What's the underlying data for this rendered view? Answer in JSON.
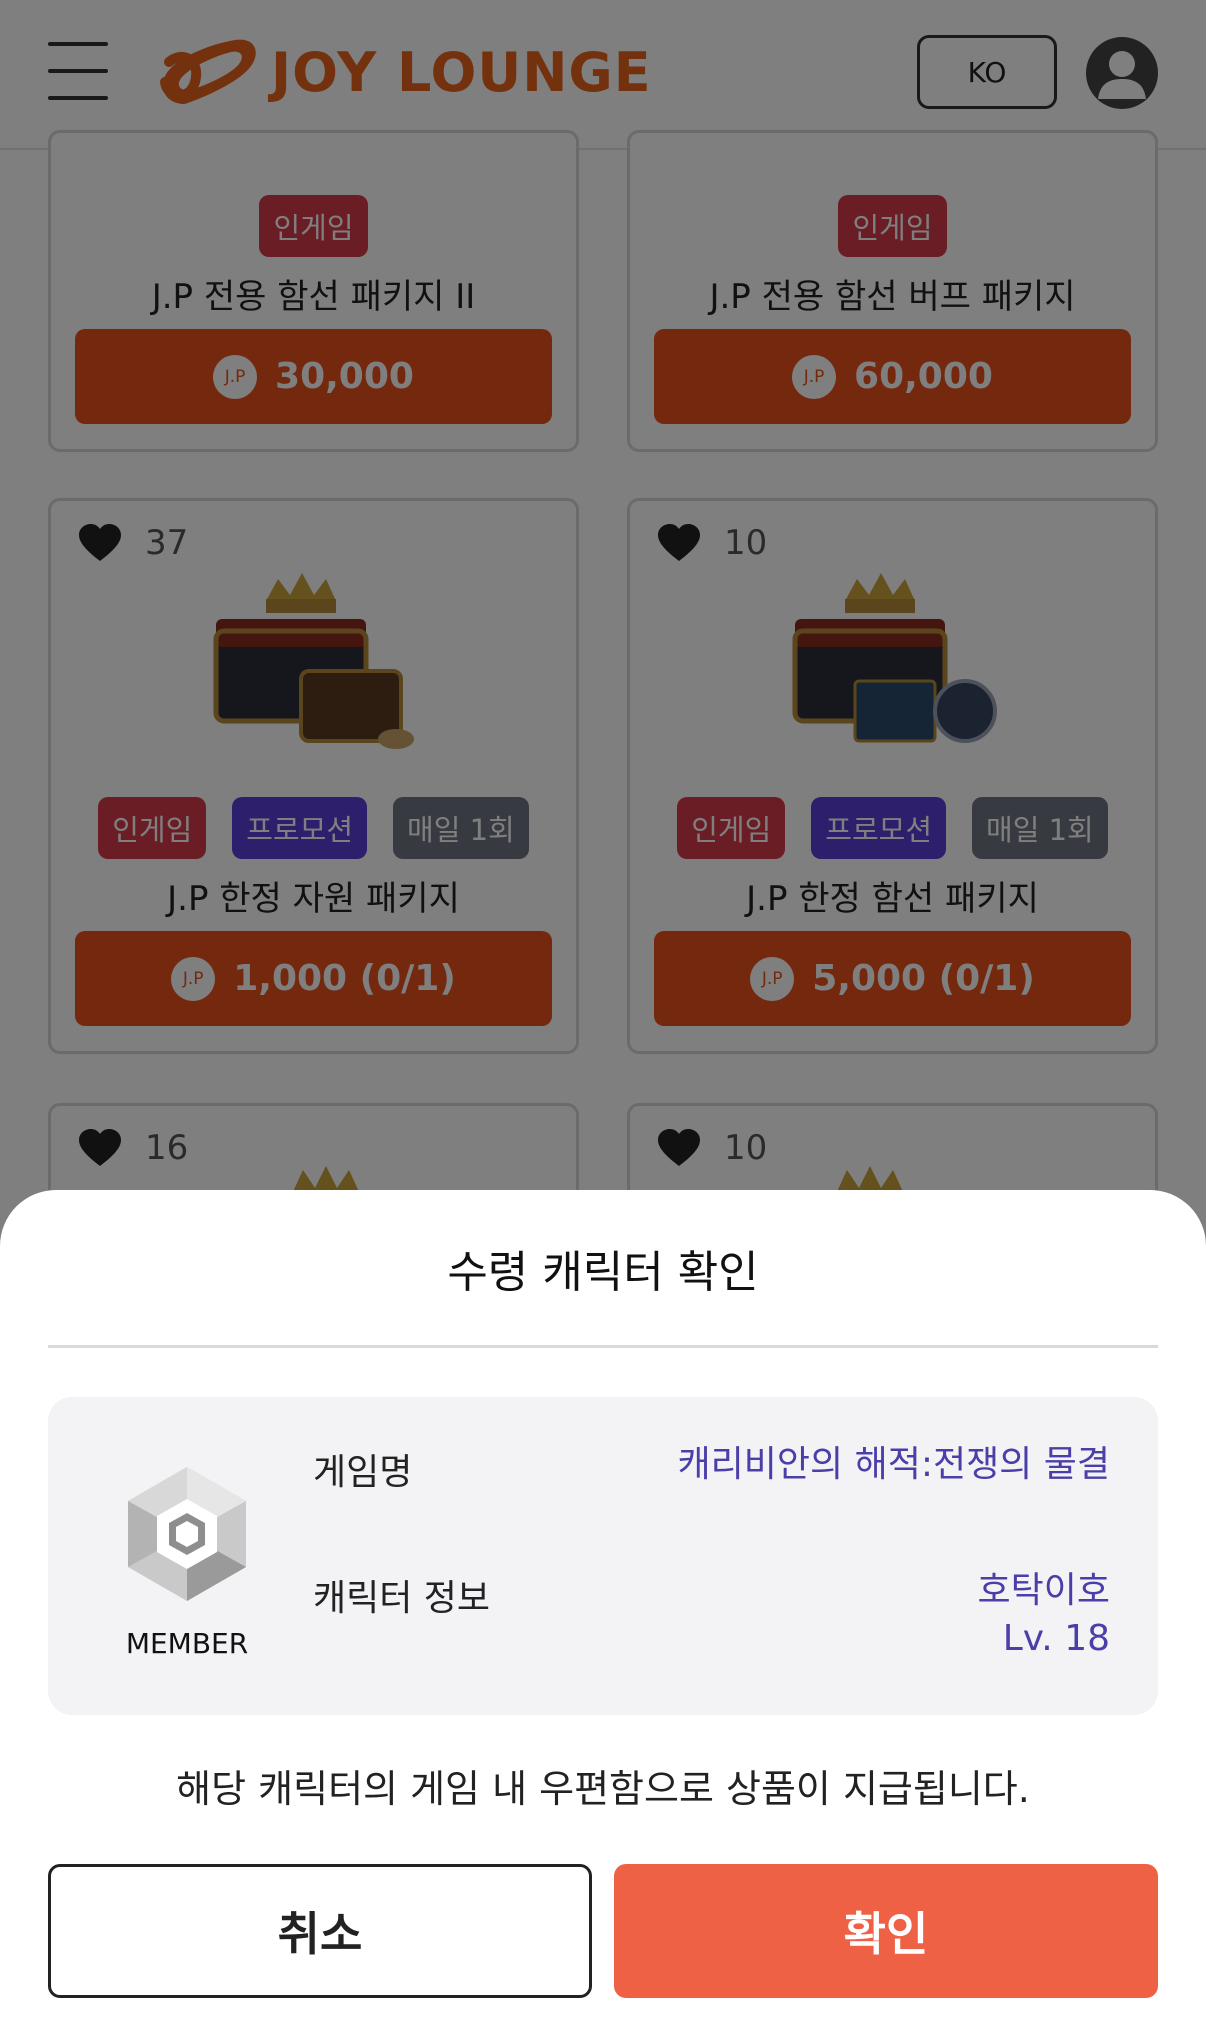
{
  "header": {
    "logo_text": "JOY LOUNGE",
    "lang_label": "KO",
    "menu_icon": "hamburger-icon",
    "avatar_icon": "user-avatar-icon"
  },
  "products": [
    {
      "tags": [
        "인게임"
      ],
      "name": "J.P 전용 함선 패키지 II",
      "price": "30,000"
    },
    {
      "tags": [
        "인게임"
      ],
      "name": "J.P 전용 함선 버프 패키지",
      "price": "60,000"
    },
    {
      "likes": "37",
      "tags": [
        "인게임",
        "프로모션",
        "매일 1회"
      ],
      "name": "J.P 한정 자원 패키지",
      "price": "1,000 (0/1)"
    },
    {
      "likes": "10",
      "tags": [
        "인게임",
        "프로모션",
        "매일 1회"
      ],
      "name": "J.P 한정 함선 패키지",
      "price": "5,000 (0/1)"
    },
    {
      "likes": "16"
    },
    {
      "likes": "10"
    }
  ],
  "currency_label": "J.P",
  "sheet": {
    "title": "수령 캐릭터 확인",
    "member_label": "MEMBER",
    "game_name_label": "게임명",
    "game_name_value": "캐리비안의 해적:전쟁의 물결",
    "character_label": "캐릭터 정보",
    "character_name": "호탁이호",
    "character_level": "Lv. 18",
    "notice": "해당 캐릭터의 게임 내 우편함으로 상품이 지급됩니다.",
    "cancel_label": "취소",
    "confirm_label": "확인"
  },
  "colors": {
    "brand_orange": "#e8621b",
    "price_button": "#e8531f",
    "confirm_button": "#ee6145",
    "tag_ingame": "#d63a4c",
    "tag_promo": "#5b3fd6",
    "tag_daily": "#6e7581",
    "info_value": "#4a3fa8"
  }
}
